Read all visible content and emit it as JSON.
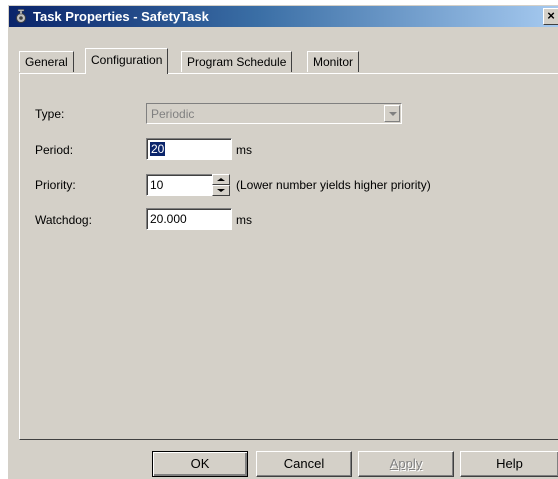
{
  "window": {
    "title": "Task Properties - SafetyTask",
    "close_glyph": "×"
  },
  "tabs": [
    {
      "label": "General",
      "active": false
    },
    {
      "label": "Configuration",
      "active": true
    },
    {
      "label": "Program Schedule",
      "active": false
    },
    {
      "label": "Monitor",
      "active": false
    }
  ],
  "form": {
    "type": {
      "label": "Type:",
      "value": "Periodic",
      "disabled": true
    },
    "period": {
      "label": "Period:",
      "value": "20",
      "unit": "ms"
    },
    "priority": {
      "label": "Priority:",
      "value": "10",
      "hint": "(Lower number yields higher priority)"
    },
    "watchdog": {
      "label": "Watchdog:",
      "value": "20.000",
      "unit": "ms"
    }
  },
  "buttons": {
    "ok": "OK",
    "cancel": "Cancel",
    "apply": "Apply",
    "help": "Help"
  },
  "colors": {
    "title_bar_start": "#0a246a",
    "title_bar_end": "#a6caf0",
    "face": "#d4d0c8"
  }
}
